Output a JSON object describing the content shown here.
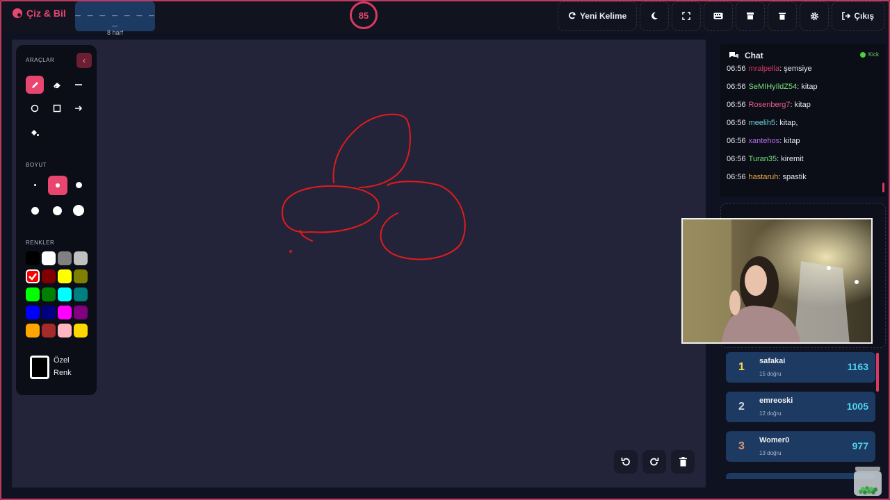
{
  "app": {
    "name": "Çiz & Bil"
  },
  "word": {
    "mask": "_ _ _ _ _ _ _ _",
    "hint": "8 harf"
  },
  "timer": {
    "value": "85"
  },
  "top_actions": {
    "new_word": "Yeni Kelime",
    "exit": "Çıkış"
  },
  "tools": {
    "title": "ARAÇLAR",
    "size_title": "BOYUT",
    "colors_title": "RENKLER",
    "custom_color": "Özel",
    "custom_color_2": "Renk",
    "active_tool": "pencil",
    "active_size_index": 1,
    "active_color": "#ff0000",
    "colors": [
      "#000000",
      "#ffffff",
      "#808080",
      "#c0c0c0",
      "#ff0000",
      "#800000",
      "#ffff00",
      "#808000",
      "#00ff00",
      "#008000",
      "#00ffff",
      "#008080",
      "#0000ff",
      "#000080",
      "#ff00ff",
      "#800080",
      "#ffa500",
      "#a52a2a",
      "#ffb6c1",
      "#ffd700"
    ]
  },
  "chat": {
    "title": "Chat",
    "platform": "Kick",
    "messages": [
      {
        "time": "06:56",
        "user": "mralpella",
        "text": "şemsiye",
        "color": "#d93a63"
      },
      {
        "time": "06:56",
        "user": "SeMIHyIldZ54",
        "text": "kitap",
        "color": "#79e27a"
      },
      {
        "time": "06:56",
        "user": "Rosenberg7",
        "text": "kitap",
        "color": "#e85c8a"
      },
      {
        "time": "06:56",
        "user": "meelih5",
        "text": "kitap,",
        "color": "#6fd3e0"
      },
      {
        "time": "06:56",
        "user": "xantehos",
        "text": "kitap",
        "color": "#b56cf0"
      },
      {
        "time": "06:56",
        "user": "Turan35",
        "text": "kiremit",
        "color": "#74e07a"
      },
      {
        "time": "06:56",
        "user": "hastaruh",
        "text": "spastik",
        "color": "#f0a848"
      }
    ]
  },
  "leaderboard": [
    {
      "rank": "1",
      "name": "safakai",
      "correct": "15 doğru",
      "score": "1163",
      "rank_color": "#ffd84a"
    },
    {
      "rank": "2",
      "name": "emreoski",
      "correct": "12 doğru",
      "score": "1005",
      "rank_color": "#d0d6e0"
    },
    {
      "rank": "3",
      "name": "Womer0",
      "correct": "13 doğru",
      "score": "977",
      "rank_color": "#e8956a"
    }
  ]
}
